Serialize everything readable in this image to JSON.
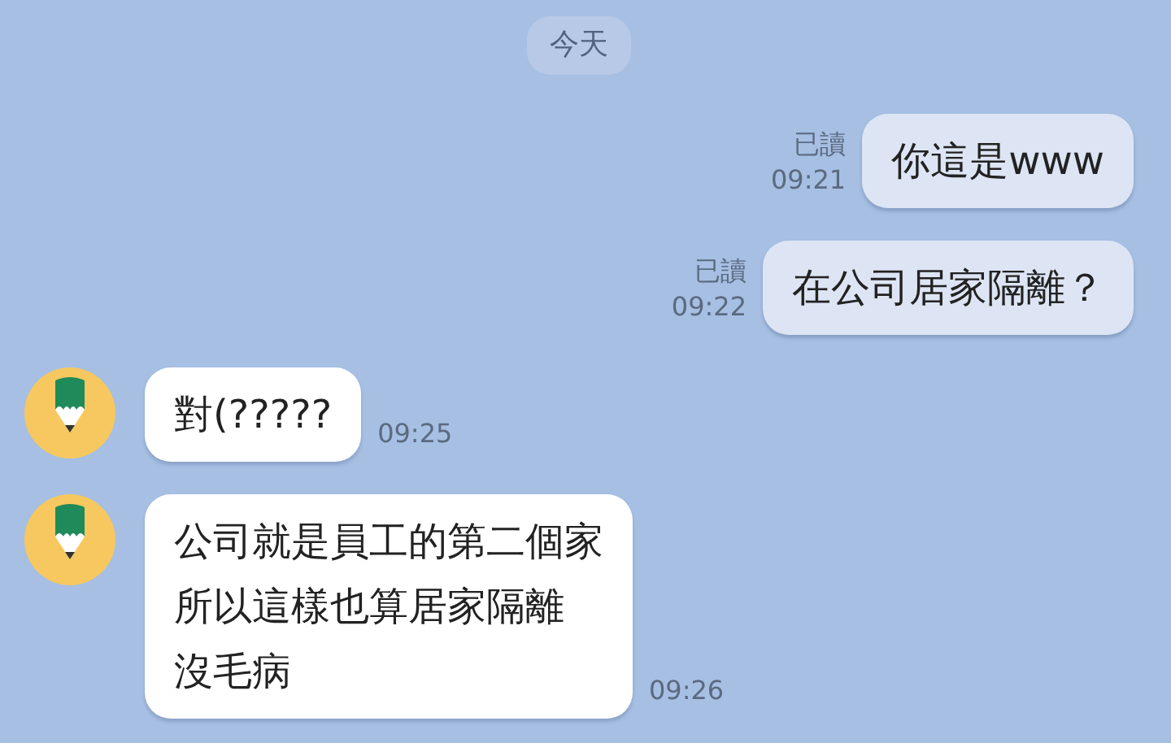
{
  "date_divider": "今天",
  "messages": [
    {
      "kind": "sent",
      "lines": [
        "你這是www"
      ],
      "read_label": "已讀",
      "time": "09:21"
    },
    {
      "kind": "sent",
      "lines": [
        "在公司居家隔離？"
      ],
      "read_label": "已讀",
      "time": "09:22"
    },
    {
      "kind": "received",
      "lines": [
        "對(?????"
      ],
      "time": "09:25"
    },
    {
      "kind": "received",
      "lines": [
        "公司就是員工的第二個家",
        "所以這樣也算居家隔離",
        "沒毛病"
      ],
      "time": "09:26"
    }
  ]
}
